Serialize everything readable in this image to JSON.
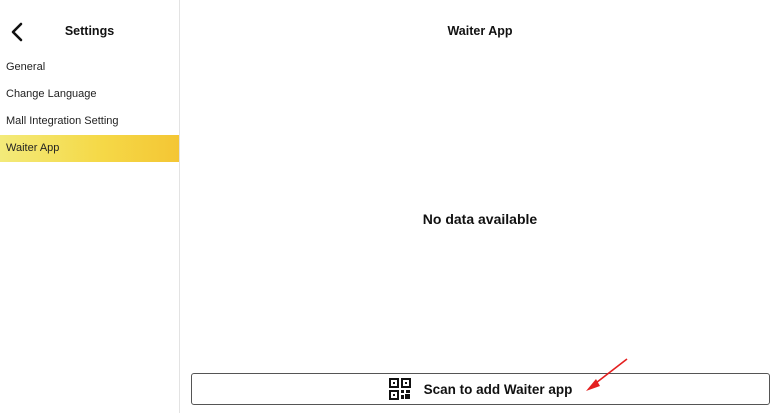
{
  "sidebar": {
    "title": "Settings",
    "back_icon": "chevron-left-icon",
    "items": [
      {
        "label": "General",
        "active": false
      },
      {
        "label": "Change Language",
        "active": false
      },
      {
        "label": "Mall Integration Setting",
        "active": false
      },
      {
        "label": "Waiter App",
        "active": true
      }
    ]
  },
  "main": {
    "title": "Waiter App",
    "empty_message": "No data available",
    "scan_button": {
      "label": "Scan to add Waiter app",
      "icon": "qr-code-icon"
    }
  },
  "colors": {
    "active_item_start": "#f3ea7a",
    "active_item_end": "#f4c634",
    "annotation_arrow": "#e41f1f"
  }
}
